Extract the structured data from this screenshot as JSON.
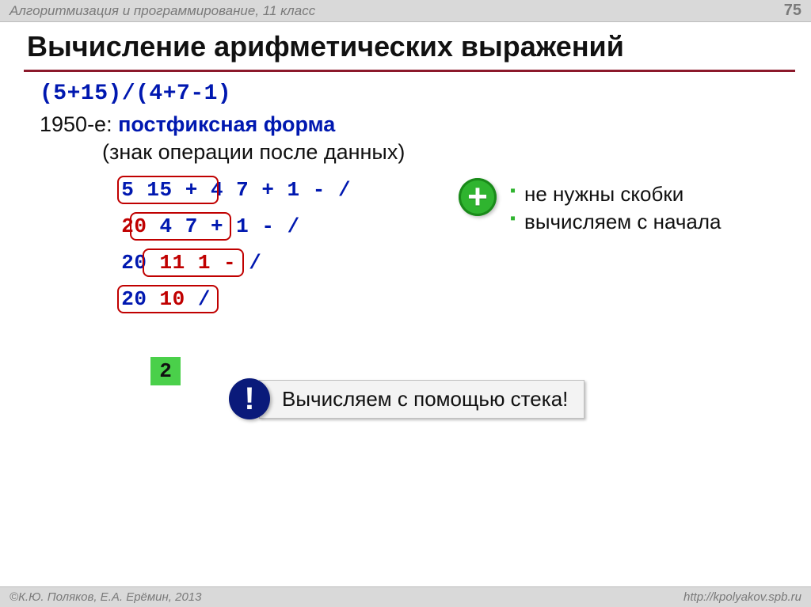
{
  "header": {
    "course": "Алгоритмизация и программирование, 11 класс",
    "page": "75"
  },
  "title": "Вычисление арифметических выражений",
  "expression": "(5+15)/(4+7-1)",
  "intro": {
    "years": "1950-е",
    "colon": ":",
    "term": "постфиксная форма",
    "sub": "(знак операции после данных)"
  },
  "steps": {
    "r1": {
      "a": "5 15 +",
      "b": " 4 7 + 1 - /"
    },
    "r2": {
      "a": "20",
      "b": " 4 7 +",
      "c": " 1 - /"
    },
    "r3": {
      "a": "20 ",
      "b": "11 1 -",
      "c": " /"
    },
    "r4": {
      "a": "20 ",
      "b": "10",
      "c": " /"
    },
    "result": "2"
  },
  "advantages": [
    "не нужны скобки",
    "вычисляем с начала"
  ],
  "callout": {
    "bang": "!",
    "text": "Вычисляем с помощью стека!"
  },
  "footer": {
    "copyright_symbol": "©",
    "authors": " К.Ю. Поляков, Е.А. Ерёмин, 2013",
    "url": "http://kpolyakov.spb.ru"
  }
}
